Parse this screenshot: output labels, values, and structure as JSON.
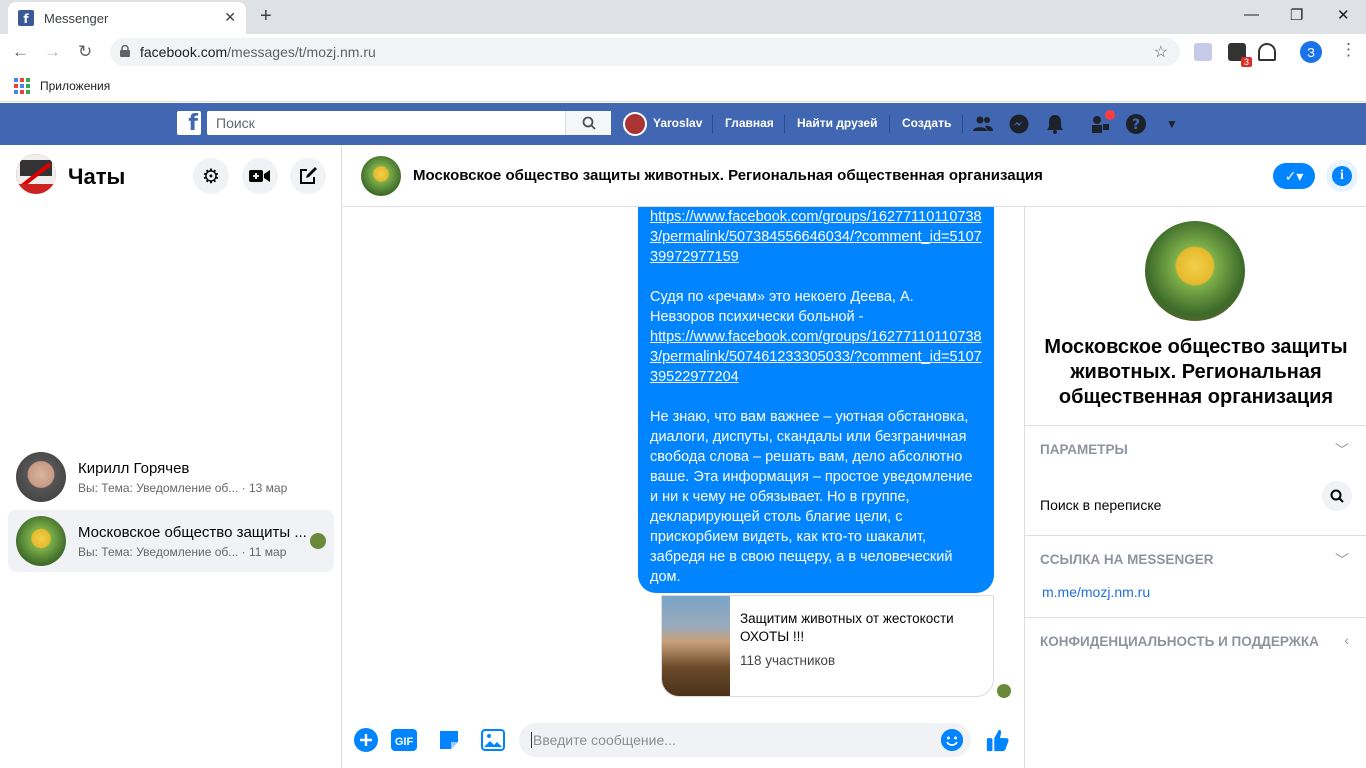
{
  "browser": {
    "tab_title": "Messenger",
    "url_host": "facebook.com",
    "url_path": "/messages/t/mozj.nm.ru",
    "bookmarks_apps": "Приложения",
    "profile_letter": "З",
    "ext_badge": "3"
  },
  "fb": {
    "search_placeholder": "Поиск",
    "user_name": "Yaroslav",
    "nav_home": "Главная",
    "nav_find_friends": "Найти друзей",
    "nav_create": "Создать"
  },
  "sidebar": {
    "title": "Чаты",
    "chats": [
      {
        "name": "Кирилл Горячев",
        "preview": "Вы: Тема: Уведомление об...",
        "date": "· 13 мар"
      },
      {
        "name": "Московское общество защиты ...",
        "preview": "Вы: Тема: Уведомление об...",
        "date": "· 11 мар"
      }
    ]
  },
  "conversation": {
    "title": "Московское общество защиты животных. Региональная общественная организация",
    "message": {
      "link1": "https://www.facebook.com/groups/162771101107383/permalink/507384556646034/?comment_id=510739972977159",
      "text1": "Судя по «речам» это некоего Деева, А. Невзоров психически больной -",
      "link2": "https://www.facebook.com/groups/162771101107383/permalink/507461233305033/?comment_id=510739522977204",
      "text2": "Не знаю, что вам важнее – уютная обстановка, диалоги, диспуты, скандалы или безграничная свобода слова – решать вам, дело абсолютно ваше. Эта информация – простое уведомление и ни к чему не обязывает. Но в группе, декларирующей столь благие цели, с прискорбием видеть, как кто-то шакалит, забредя не в свою пещеру, а в человеческий дом."
    },
    "card": {
      "title": "Защитим животных от жестокости ОХОТЫ !!!",
      "members": "118 участников"
    },
    "composer_placeholder": "Введите сообщение..."
  },
  "right_panel": {
    "name": "Московское общество защиты животных. Региональная общественная организация",
    "section_params": "ПАРАМЕТРЫ",
    "search_label": "Поиск в переписке",
    "section_link": "ССЫЛКА НА MESSENGER",
    "messenger_link": "m.me/mozj.nm.ru",
    "section_privacy": "КОНФИДЕНЦИАЛЬНОСТЬ И ПОДДЕРЖКА"
  },
  "colors": {
    "fb_blue": "#4267b2",
    "messenger_blue": "#0084ff"
  }
}
